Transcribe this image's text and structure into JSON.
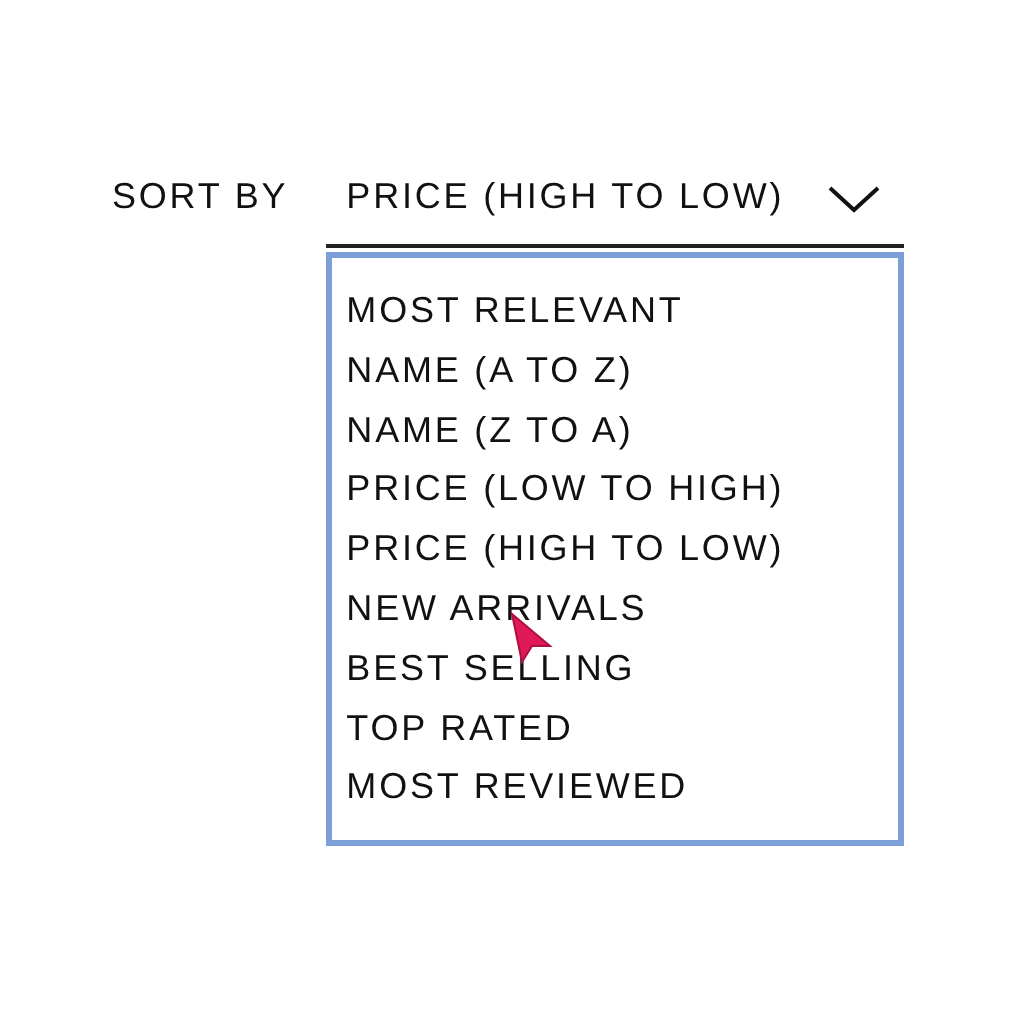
{
  "sort": {
    "label": "SORT BY",
    "value": "PRICE (HIGH TO LOW)"
  },
  "options": [
    "MOST RELEVANT",
    "NAME (A TO Z)",
    "NAME (Z TO A)",
    "PRICE (LOW TO HIGH)",
    "PRICE (HIGH TO LOW)",
    "NEW ARRIVALS",
    "BEST SELLING",
    "TOP RATED",
    "MOST REVIEWED"
  ]
}
